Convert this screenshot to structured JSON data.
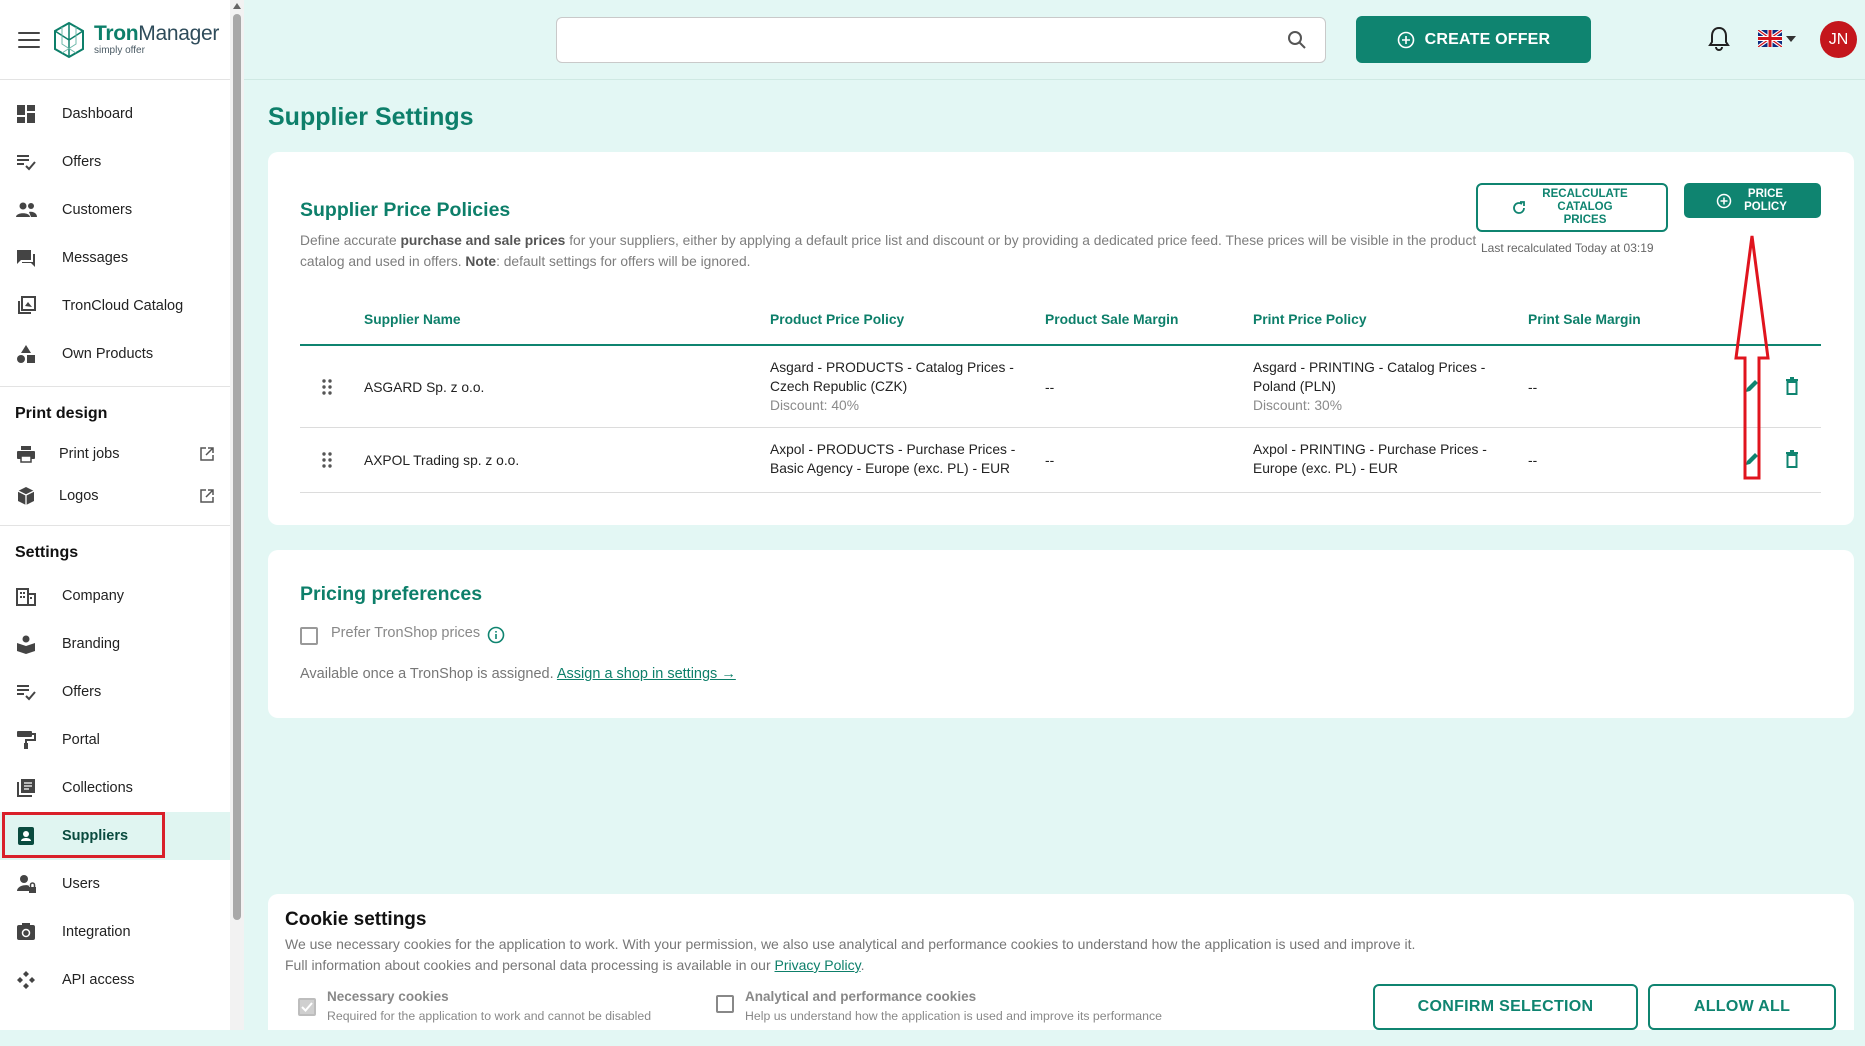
{
  "app": {
    "name_bold": "Tron",
    "name_rest": "Manager",
    "tagline": "simply offer"
  },
  "sidebar": {
    "main": [
      {
        "label": "Dashboard",
        "icon": "dashboard-icon"
      },
      {
        "label": "Offers",
        "icon": "offers-icon"
      },
      {
        "label": "Customers",
        "icon": "customers-icon"
      },
      {
        "label": "Messages",
        "icon": "messages-icon"
      },
      {
        "label": "TronCloud Catalog",
        "icon": "catalog-icon"
      },
      {
        "label": "Own Products",
        "icon": "shapes-icon"
      }
    ],
    "print_design": {
      "title": "Print design",
      "items": [
        {
          "label": "Print jobs",
          "icon": "printer-icon"
        },
        {
          "label": "Logos",
          "icon": "cube-icon"
        }
      ]
    },
    "settings": {
      "title": "Settings",
      "items": [
        {
          "label": "Company",
          "icon": "building-icon"
        },
        {
          "label": "Branding",
          "icon": "branding-icon"
        },
        {
          "label": "Offers",
          "icon": "offers-icon"
        },
        {
          "label": "Portal",
          "icon": "paint-roller-icon"
        },
        {
          "label": "Collections",
          "icon": "collections-icon"
        },
        {
          "label": "Suppliers",
          "icon": "supplier-badge-icon",
          "active": true
        },
        {
          "label": "Users",
          "icon": "user-lock-icon"
        },
        {
          "label": "Integration",
          "icon": "integration-icon"
        },
        {
          "label": "API access",
          "icon": "api-icon"
        }
      ]
    }
  },
  "topbar": {
    "search": {
      "value": "",
      "placeholder": ""
    },
    "create_offer_label": "CREATE OFFER",
    "avatar_initials": "JN",
    "language": "EN"
  },
  "page": {
    "title": "Supplier Settings"
  },
  "policies": {
    "title": "Supplier Price Policies",
    "desc": {
      "p1": "Define accurate ",
      "b1": "purchase and sale prices",
      "p2": " for your suppliers, either by applying a default price list and discount or by providing a dedicated price feed. These prices will be visible in the product catalog and used in offers. ",
      "b2": "Note",
      "p3": ": default settings for offers will be ignored."
    },
    "recalc_label": "RECALCULATE CATALOG PRICES",
    "price_policy_label": "PRICE POLICY",
    "last_recalculated": "Last recalculated Today at 03:19",
    "columns": [
      "Supplier Name",
      "Product Price Policy",
      "Product Sale Margin",
      "Print Price Policy",
      "Print Sale Margin"
    ],
    "rows": [
      {
        "supplier": "ASGARD Sp. z o.o.",
        "product_policy": [
          "Asgard - PRODUCTS - Catalog Prices -",
          "Czech Republic (CZK)"
        ],
        "product_discount": "Discount: 40%",
        "product_margin": "--",
        "print_policy": [
          "Asgard - PRINTING - Catalog Prices -",
          "Poland (PLN)"
        ],
        "print_discount": "Discount: 30%",
        "print_margin": "--"
      },
      {
        "supplier": "AXPOL Trading sp. z o.o.",
        "product_policy": [
          "Axpol - PRODUCTS - Purchase Prices -",
          "Basic Agency - Europe (exc. PL) - EUR"
        ],
        "product_margin": "--",
        "print_policy": [
          "Axpol - PRINTING - Purchase Prices -",
          "Europe (exc. PL) - EUR"
        ],
        "print_margin": "--"
      }
    ]
  },
  "preferences": {
    "title": "Pricing preferences",
    "prefer_label": "Prefer TronShop prices",
    "available_text": "Available once a TronShop is assigned. ",
    "assign_link": "Assign a shop in settings →"
  },
  "cookie": {
    "title": "Cookie settings",
    "line1": "We use necessary cookies for the application to work. With your permission, we also use analytical and performance cookies to understand how the application is used and improve it.",
    "line2_prefix": "Full information about cookies and personal data processing is available in our ",
    "privacy_link": "Privacy Policy",
    "line2_suffix": ".",
    "necessary_title": "Necessary cookies",
    "necessary_sub": "Required for the application to work and cannot be disabled",
    "analytics_title": "Analytical and performance cookies",
    "analytics_sub": "Help us understand how the application is used and improve its performance",
    "confirm_label": "CONFIRM SELECTION",
    "allow_label": "ALLOW ALL"
  },
  "colors": {
    "accent": "#0f8470",
    "accent_text": "#0d7f6a",
    "background": "#e3f7f4",
    "avatar": "#c4161c",
    "highlight": "#d9202a"
  }
}
